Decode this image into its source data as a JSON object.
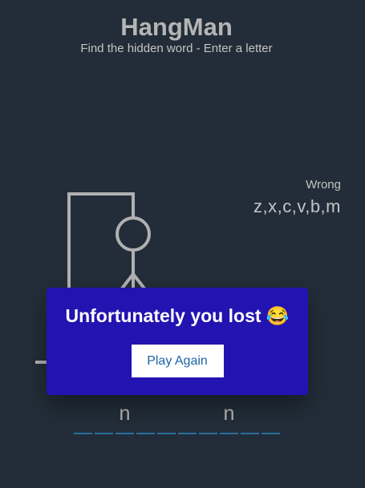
{
  "header": {
    "title": "HangMan",
    "subtitle": "Find the hidden word - Enter a letter"
  },
  "wrong": {
    "label": "Wrong",
    "letters": "z,x,c,v,b,m"
  },
  "word": {
    "letters": [
      "",
      "",
      "n",
      "",
      "",
      "",
      "",
      "n",
      "",
      ""
    ]
  },
  "popup": {
    "message": "Unfortunately you lost 😂",
    "button_label": "Play Again"
  },
  "colors": {
    "background": "#222d39",
    "popup": "#2313b0",
    "slot_underline": "#2a6f9e",
    "gallows": "#b0b0b0",
    "button_text": "#1d64a6"
  }
}
